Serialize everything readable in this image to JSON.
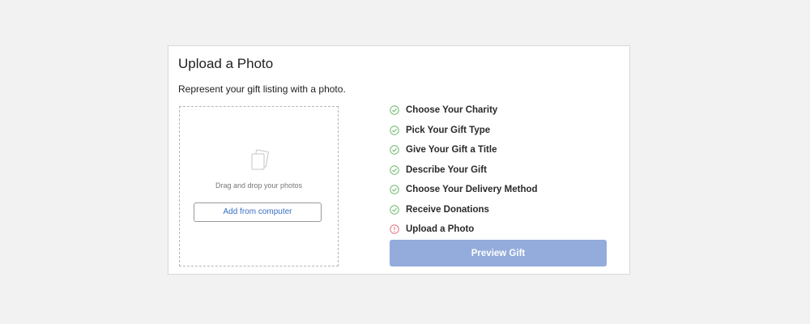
{
  "card": {
    "title": "Upload a Photo",
    "subtitle": "Represent your gift listing with a photo."
  },
  "dropzone": {
    "icon": "photos-icon",
    "text": "Drag and drop your photos",
    "button_label": "Add from computer"
  },
  "steps": [
    {
      "label": "Choose Your Charity",
      "status": "complete",
      "icon": "check-circle-icon"
    },
    {
      "label": "Pick Your Gift Type",
      "status": "complete",
      "icon": "check-circle-icon"
    },
    {
      "label": "Give Your Gift a Title",
      "status": "complete",
      "icon": "check-circle-icon"
    },
    {
      "label": "Describe Your Gift",
      "status": "complete",
      "icon": "check-circle-icon"
    },
    {
      "label": "Choose Your Delivery Method",
      "status": "complete",
      "icon": "check-circle-icon"
    },
    {
      "label": "Receive Donations",
      "status": "complete",
      "icon": "check-circle-icon"
    },
    {
      "label": "Upload a Photo",
      "status": "incomplete",
      "icon": "alert-circle-icon"
    }
  ],
  "preview_button": {
    "label": "Preview Gift",
    "state": "disabled"
  },
  "colors": {
    "page_background": "#f2f2f2",
    "complete_icon": "#6cb86a",
    "incomplete_icon": "#e0707a",
    "link_blue": "#3a6fc4",
    "preview_button": "#93acdb"
  }
}
